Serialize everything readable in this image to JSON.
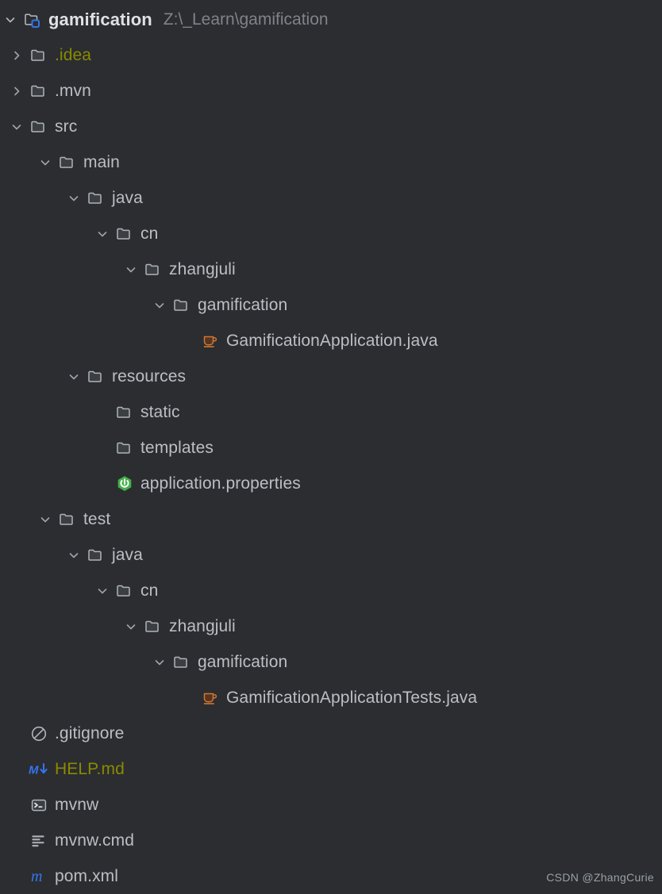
{
  "window": {
    "background": "#2b2d30",
    "default_text_color": "#bcbec4",
    "muted_text_color": "#7f8389",
    "highlight_text_color": "#8a8a00"
  },
  "project": {
    "name": "gamification",
    "path": "Z:\\_Learn\\gamification",
    "icon": "module-folder-icon"
  },
  "tree": {
    "nodes": [
      {
        "label": ".idea",
        "indent": 1,
        "state": "collapsed",
        "icon": "folder-icon",
        "color": "yellow"
      },
      {
        "label": ".mvn",
        "indent": 1,
        "state": "collapsed",
        "icon": "folder-icon",
        "color": "default"
      },
      {
        "label": "src",
        "indent": 1,
        "state": "expanded",
        "icon": "folder-icon",
        "color": "default"
      },
      {
        "label": "main",
        "indent": 2,
        "state": "expanded",
        "icon": "folder-icon",
        "color": "default"
      },
      {
        "label": "java",
        "indent": 3,
        "state": "expanded",
        "icon": "folder-icon",
        "color": "default"
      },
      {
        "label": "cn",
        "indent": 4,
        "state": "expanded",
        "icon": "folder-icon",
        "color": "default"
      },
      {
        "label": "zhangjuli",
        "indent": 5,
        "state": "expanded",
        "icon": "folder-icon",
        "color": "default"
      },
      {
        "label": "gamification",
        "indent": 6,
        "state": "expanded",
        "icon": "folder-icon",
        "color": "default"
      },
      {
        "label": "GamificationApplication.java",
        "indent": 7,
        "state": "leaf",
        "icon": "java-class-icon",
        "color": "default"
      },
      {
        "label": "resources",
        "indent": 3,
        "state": "expanded",
        "icon": "folder-icon",
        "color": "default"
      },
      {
        "label": "static",
        "indent": 4,
        "state": "leaf",
        "icon": "folder-icon",
        "color": "default"
      },
      {
        "label": "templates",
        "indent": 4,
        "state": "leaf",
        "icon": "folder-icon",
        "color": "default"
      },
      {
        "label": "application.properties",
        "indent": 4,
        "state": "leaf",
        "icon": "spring-boot-icon",
        "color": "default"
      },
      {
        "label": "test",
        "indent": 2,
        "state": "expanded",
        "icon": "folder-icon",
        "color": "default"
      },
      {
        "label": "java",
        "indent": 3,
        "state": "expanded",
        "icon": "folder-icon",
        "color": "default"
      },
      {
        "label": "cn",
        "indent": 4,
        "state": "expanded",
        "icon": "folder-icon",
        "color": "default"
      },
      {
        "label": "zhangjuli",
        "indent": 5,
        "state": "expanded",
        "icon": "folder-icon",
        "color": "default"
      },
      {
        "label": "gamification",
        "indent": 6,
        "state": "expanded",
        "icon": "folder-icon",
        "color": "default"
      },
      {
        "label": "GamificationApplicationTests.java",
        "indent": 7,
        "state": "leaf",
        "icon": "java-class-icon",
        "color": "default"
      },
      {
        "label": ".gitignore",
        "indent": 1,
        "state": "leaf",
        "icon": "gitignore-icon",
        "color": "default"
      },
      {
        "label": "HELP.md",
        "indent": 1,
        "state": "leaf",
        "icon": "markdown-icon",
        "color": "yellow"
      },
      {
        "label": "mvnw",
        "indent": 1,
        "state": "leaf",
        "icon": "terminal-icon",
        "color": "default"
      },
      {
        "label": "mvnw.cmd",
        "indent": 1,
        "state": "leaf",
        "icon": "text-file-icon",
        "color": "default"
      },
      {
        "label": "pom.xml",
        "indent": 1,
        "state": "leaf",
        "icon": "maven-icon",
        "color": "default"
      }
    ]
  },
  "watermark": {
    "text": "CSDN @ZhangCurie"
  }
}
